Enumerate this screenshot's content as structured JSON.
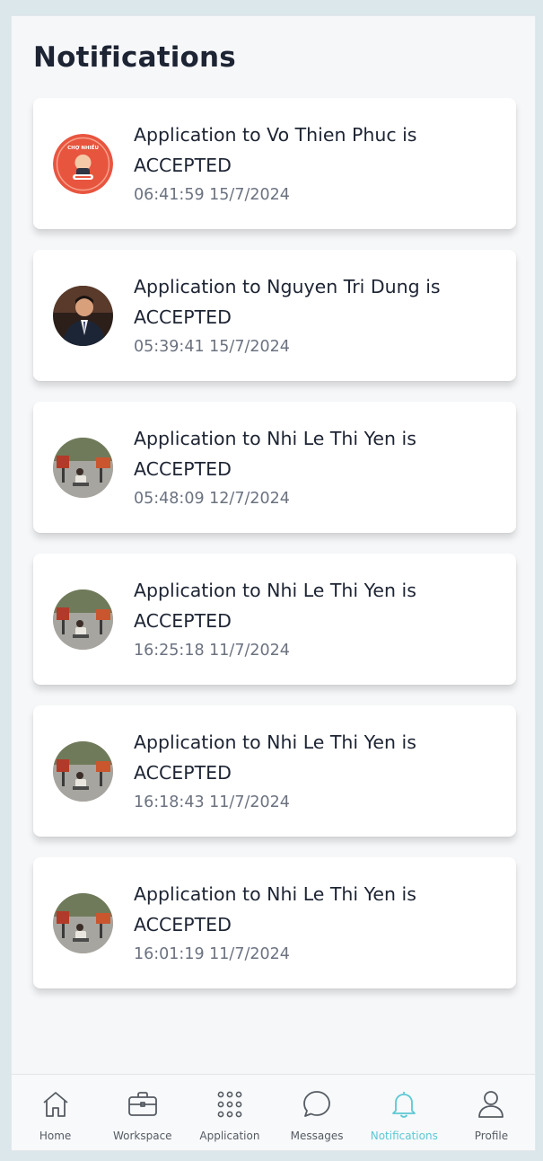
{
  "page": {
    "title": "Notifications"
  },
  "notifications": [
    {
      "message": "Application to Vo Thien Phuc is ACCEPTED",
      "time": "06:41:59 15/7/2024",
      "avatar": "logo",
      "avatar_text": "CHỢ NHIỀU"
    },
    {
      "message": "Application to Nguyen Tri Dung is ACCEPTED",
      "time": "05:39:41 15/7/2024",
      "avatar": "portrait"
    },
    {
      "message": "Application to Nhi Le Thi Yen is ACCEPTED",
      "time": "05:48:09 12/7/2024",
      "avatar": "photo"
    },
    {
      "message": "Application to Nhi Le Thi Yen is ACCEPTED",
      "time": "16:25:18 11/7/2024",
      "avatar": "photo"
    },
    {
      "message": "Application to Nhi Le Thi Yen is ACCEPTED",
      "time": "16:18:43 11/7/2024",
      "avatar": "photo"
    },
    {
      "message": "Application to Nhi Le Thi Yen is ACCEPTED",
      "time": "16:01:19 11/7/2024",
      "avatar": "photo"
    }
  ],
  "nav": {
    "items": [
      {
        "label": "Home",
        "icon": "home-icon"
      },
      {
        "label": "Workspace",
        "icon": "briefcase-icon"
      },
      {
        "label": "Application",
        "icon": "grid-dots-icon"
      },
      {
        "label": "Messages",
        "icon": "chat-bubble-icon"
      },
      {
        "label": "Notifications",
        "icon": "bell-icon",
        "active": true
      },
      {
        "label": "Profile",
        "icon": "user-icon"
      }
    ],
    "active_color": "#5cc8d4",
    "inactive_color": "#555b63"
  }
}
